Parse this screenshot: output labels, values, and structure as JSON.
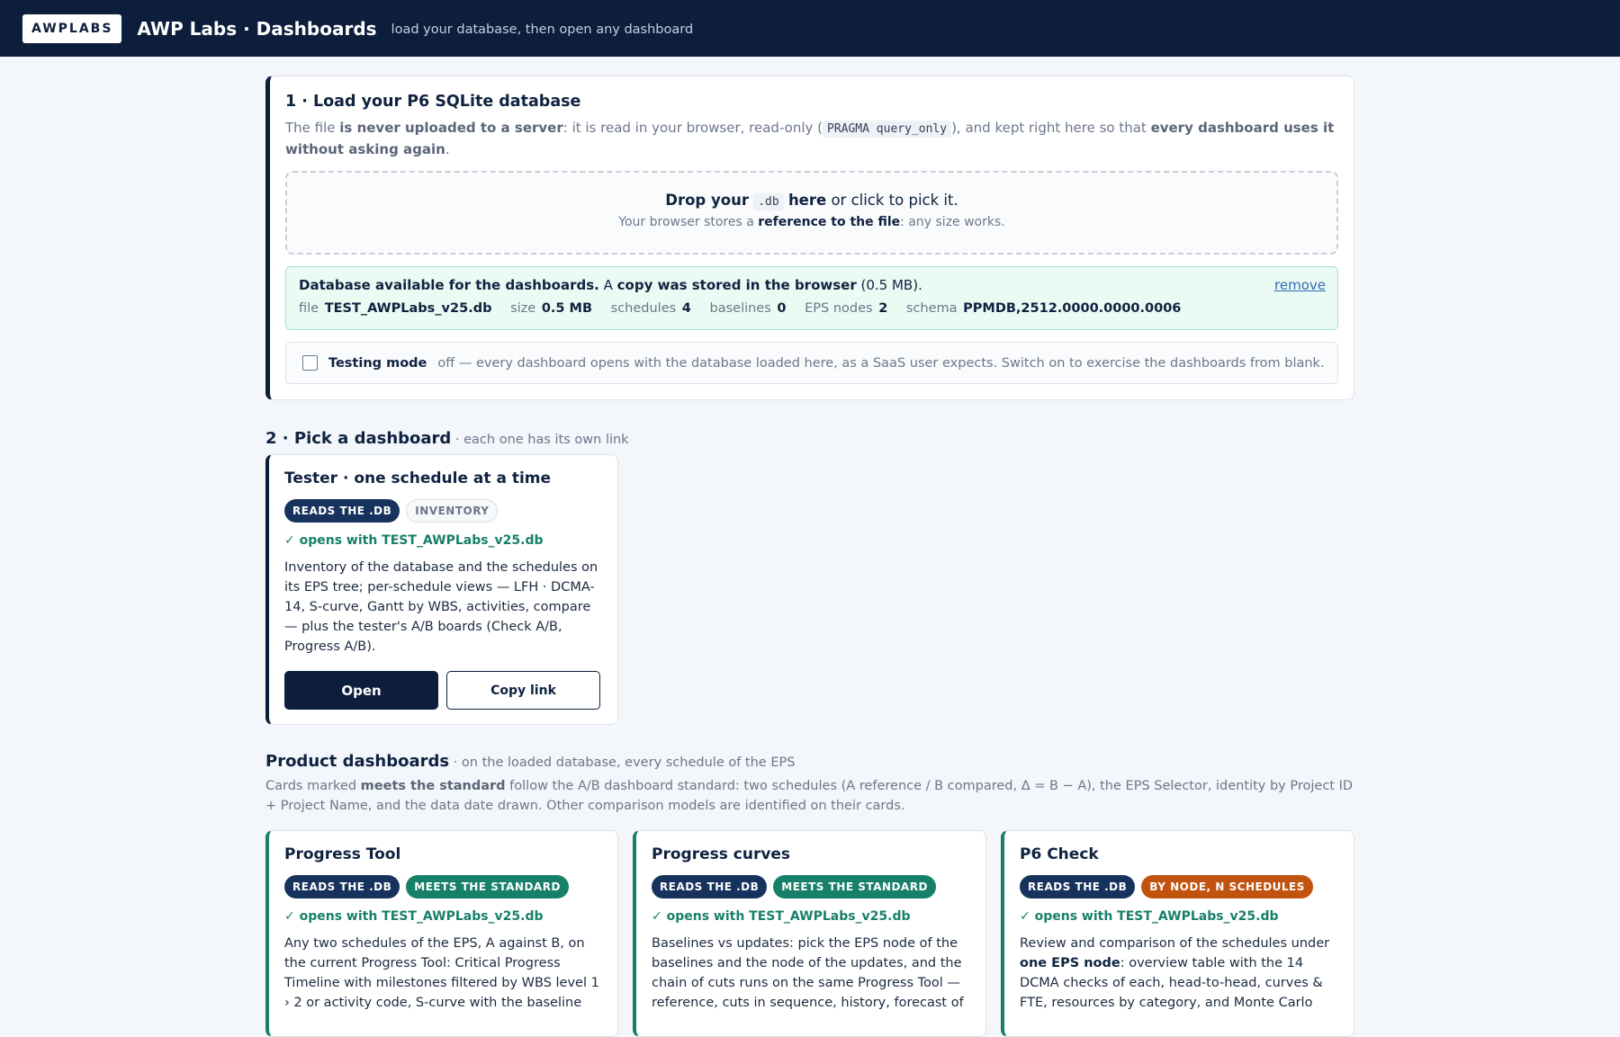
{
  "header": {
    "logo": "AWPLABS",
    "title": "AWP Labs · Dashboards",
    "subtitle": "load your database, then open any dashboard"
  },
  "load": {
    "title": "1 · Load your P6 SQLite database",
    "note_1": "The file ",
    "note_b1": "is never uploaded to a server",
    "note_2": ": it is read in your browser, read-only (",
    "note_code": "PRAGMA query_only",
    "note_3": "), and kept right here so that ",
    "note_b2": "every dashboard uses it without asking again",
    "note_4": ".",
    "drop_b1": "Drop your",
    "drop_code": ".db",
    "drop_b2": "here",
    "drop_rest": " or click to pick it.",
    "drop_sub_1": "Your browser stores a ",
    "drop_sub_b": "reference to the file",
    "drop_sub_2": ": any size works.",
    "status_b1": "Database available for the dashboards.",
    "status_1": " A ",
    "status_b2": "copy was stored in the browser",
    "status_2": " (0.5 MB).",
    "remove_label": "remove",
    "file_k": "file",
    "file_v": "TEST_AWPLabs_v25.db",
    "size_k": "size",
    "size_v": "0.5 MB",
    "schedules_k": "schedules",
    "schedules_v": "4",
    "baselines_k": "baselines",
    "baselines_v": "0",
    "eps_k": "EPS nodes",
    "eps_v": "2",
    "schema_k": "schema",
    "schema_v": "PPMDB,2512.0000.0000.0006",
    "testing_label": "Testing mode",
    "testing_desc": "off — every dashboard opens with the database loaded here, as a SaaS user expects. Switch on to exercise the dashboards from blank."
  },
  "pick": {
    "title": "2 · Pick a dashboard",
    "subtitle": " · each one has its own link"
  },
  "tester": {
    "title": "Tester · one schedule at a time",
    "badge1": "READS THE .DB",
    "badge2": "INVENTORY",
    "opens": "✓ opens with TEST_AWPLabs_v25.db",
    "desc": "Inventory of the database and the schedules on its EPS tree; per-schedule views — LFH · DCMA-14, S-curve, Gantt by WBS, activities, compare — plus the tester's A/B boards (Check A/B, Progress A/B).",
    "open_label": "Open",
    "copy_label": "Copy link"
  },
  "product": {
    "title": "Product dashboards",
    "subtitle": " · on the loaded database, every schedule of the EPS",
    "note_1": "Cards marked ",
    "note_b": "meets the standard",
    "note_2": " follow the A/B dashboard standard: two schedules (A reference / B compared, Δ = B − A), the EPS Selector, identity by Project ID + Project Name, and the data date drawn. Other comparison models are identified on their cards."
  },
  "cards": [
    {
      "title": "Progress Tool",
      "badge1": "READS THE .DB",
      "badge2": "MEETS THE STANDARD",
      "opens": "✓ opens with TEST_AWPLabs_v25.db",
      "desc": "Any two schedules of the EPS, A against B, on the current Progress Tool: Critical Progress Timeline with milestones filtered by WBS level 1 › 2 or activity code, S-curve with the baseline"
    },
    {
      "title": "Progress curves",
      "badge1": "READS THE .DB",
      "badge2": "MEETS THE STANDARD",
      "opens": "✓ opens with TEST_AWPLabs_v25.db",
      "desc": "Baselines vs updates: pick the EPS node of the baselines and the node of the updates, and the chain of cuts runs on the same Progress Tool — reference, cuts in sequence, history, forecast of"
    },
    {
      "title": "P6 Check",
      "badge1": "READS THE .DB",
      "badge2": "BY NODE, N SCHEDULES",
      "opens": "✓ opens with TEST_AWPLabs_v25.db",
      "desc_1": "Review and comparison of the schedules under ",
      "desc_b": "one EPS node",
      "desc_2": ": overview table with the 14 DCMA checks of each, head-to-head, curves & FTE, resources by category, and Monte Carlo"
    }
  ],
  "colors": {
    "navy": "#0c1e3c",
    "teal": "#17806a",
    "orange": "#c2530f",
    "success_bg": "#ebfaf3"
  }
}
